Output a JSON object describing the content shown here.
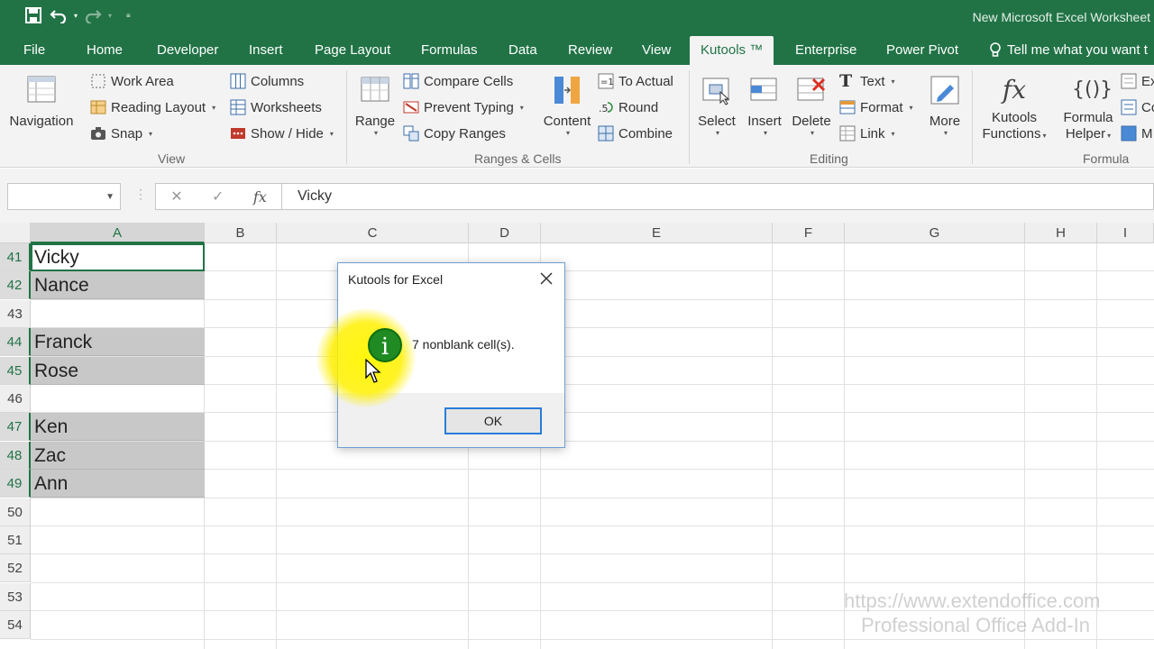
{
  "window": {
    "title": "New Microsoft Excel Worksheet"
  },
  "colors": {
    "excel_green": "#217346",
    "ribbon_bg": "#f3f3f3",
    "selected_cell_bg": "#c8c8c8",
    "info_icon": "#1f8b22",
    "highlight": "#fff400",
    "ok_focus": "#2a7cd8"
  },
  "tabs": [
    {
      "label": "File"
    },
    {
      "label": "Home"
    },
    {
      "label": "Developer"
    },
    {
      "label": "Insert"
    },
    {
      "label": "Page Layout"
    },
    {
      "label": "Formulas"
    },
    {
      "label": "Data"
    },
    {
      "label": "Review"
    },
    {
      "label": "View"
    },
    {
      "label": "Kutools ™",
      "active": true
    },
    {
      "label": "Enterprise"
    },
    {
      "label": "Power Pivot"
    }
  ],
  "tell_me": "Tell me what you want t",
  "ribbon": {
    "view": {
      "group_label": "View",
      "navigation": "Navigation",
      "work_area": "Work Area",
      "reading_layout": "Reading Layout",
      "snap": "Snap",
      "columns": "Columns",
      "worksheets": "Worksheets",
      "show_hide": "Show / Hide"
    },
    "ranges": {
      "group_label": "Ranges & Cells",
      "range": "Range",
      "compare_cells": "Compare Cells",
      "prevent_typing": "Prevent Typing",
      "copy_ranges": "Copy Ranges",
      "content": "Content",
      "to_actual": "To Actual",
      "round": "Round",
      "combine": "Combine"
    },
    "editing": {
      "group_label": "Editing",
      "select": "Select",
      "insert": "Insert",
      "delete": "Delete",
      "text": "Text",
      "format": "Format",
      "link": "Link",
      "more": "More"
    },
    "formula": {
      "group_label": "Formula",
      "kutools_functions_1": "Kutools",
      "kutools_functions_2": "Functions",
      "formula_helper_1": "Formula",
      "formula_helper_2": "Helper",
      "cut_ex": "Ex",
      "cut_co": "Co",
      "cut_m": "M"
    }
  },
  "formula_bar": {
    "name_box": "",
    "value": "Vicky"
  },
  "columns": [
    "A",
    "B",
    "C",
    "D",
    "E",
    "F",
    "G",
    "H",
    "I"
  ],
  "rows": [
    {
      "num": "41",
      "a": "Vicky",
      "selected": true
    },
    {
      "num": "42",
      "a": "Nance",
      "selected": true
    },
    {
      "num": "43",
      "a": "",
      "selected": false
    },
    {
      "num": "44",
      "a": "Franck",
      "selected": true
    },
    {
      "num": "45",
      "a": "Rose",
      "selected": true
    },
    {
      "num": "46",
      "a": "",
      "selected": false
    },
    {
      "num": "47",
      "a": "Ken",
      "selected": true
    },
    {
      "num": "48",
      "a": "Zac",
      "selected": true
    },
    {
      "num": "49",
      "a": "Ann",
      "selected": true
    },
    {
      "num": "50",
      "a": "",
      "selected": false
    },
    {
      "num": "51",
      "a": "",
      "selected": false
    },
    {
      "num": "52",
      "a": "",
      "selected": false
    },
    {
      "num": "53",
      "a": "",
      "selected": false
    },
    {
      "num": "54",
      "a": "",
      "selected": false
    }
  ],
  "dialog": {
    "title": "Kutools for Excel",
    "message": "7 nonblank cell(s).",
    "ok": "OK",
    "icon": "info-icon"
  },
  "watermark": {
    "line1": "https://www.extendoffice.com",
    "line2": "Professional Office Add-In"
  }
}
